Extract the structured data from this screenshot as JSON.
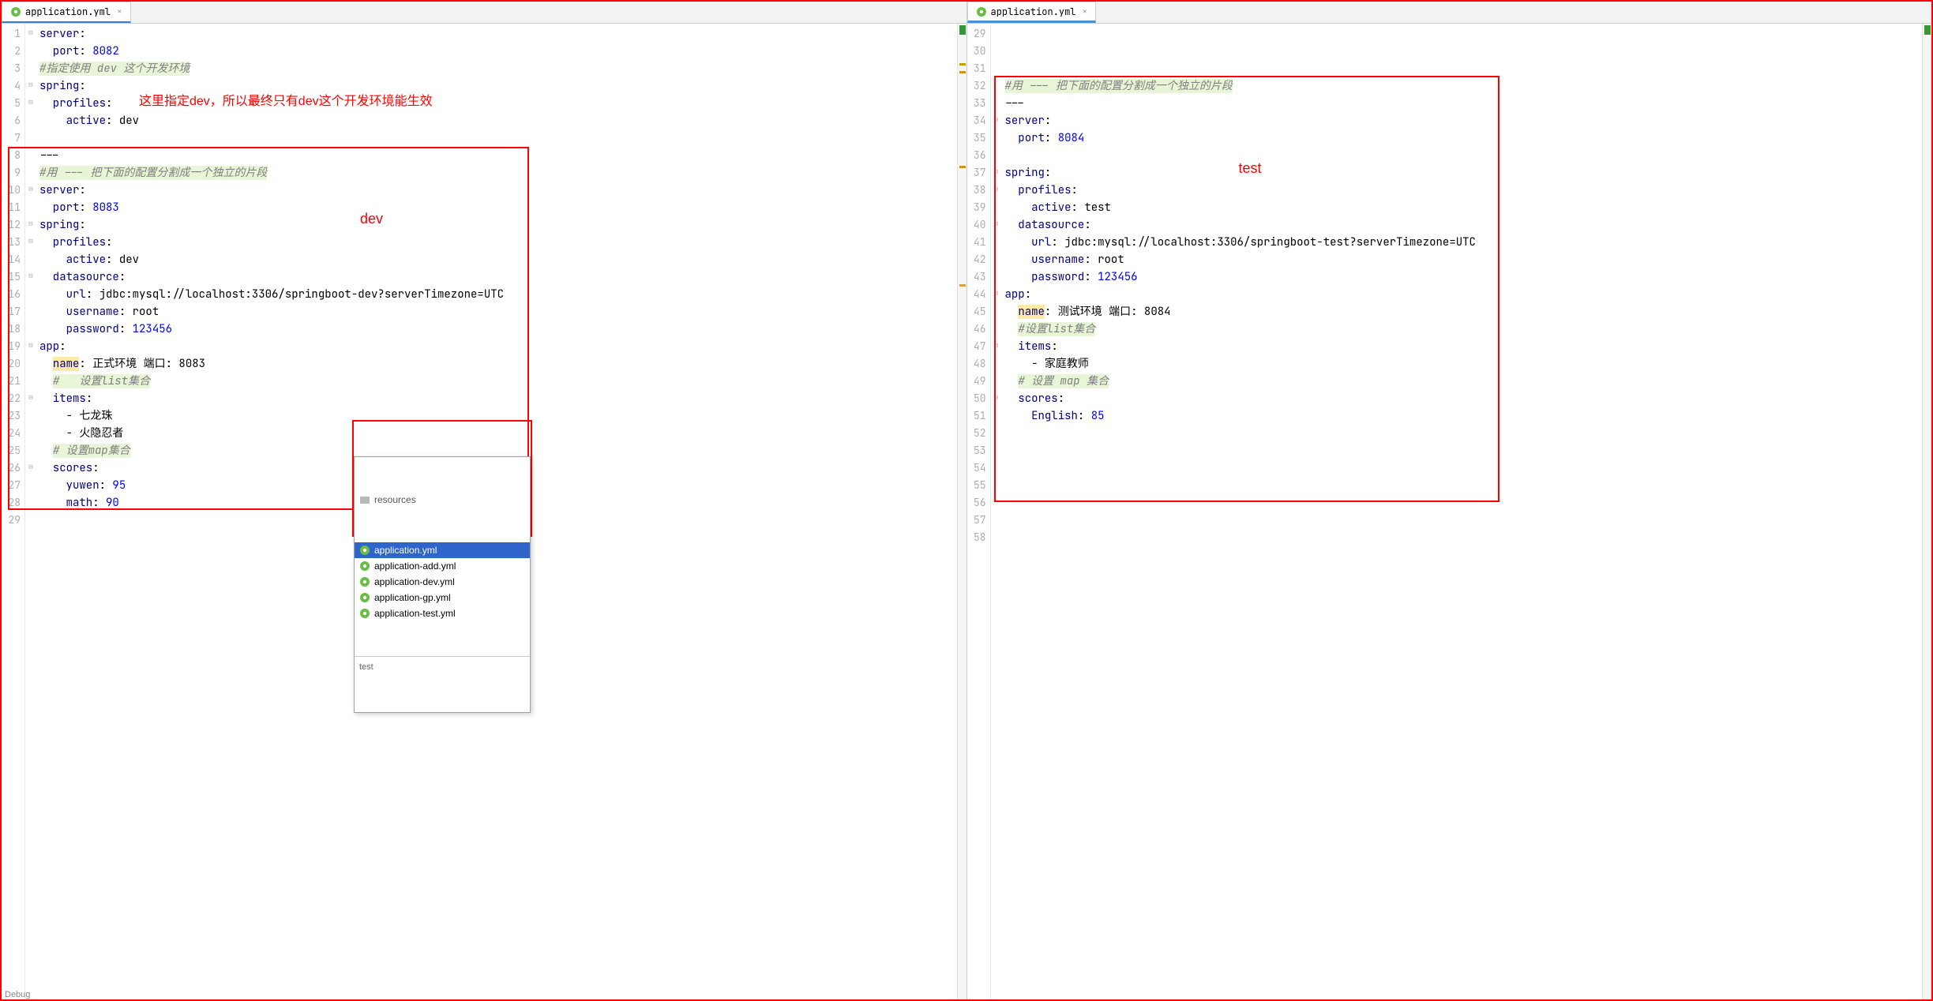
{
  "tab_left": {
    "filename": "application.yml"
  },
  "tab_right": {
    "filename": "application.yml"
  },
  "annotations": {
    "top_red": "这里指定dev，所以最终只有dev这个开发环境能生效",
    "dev_label": "dev",
    "test_label": "test"
  },
  "popup": {
    "folder": "resources",
    "items": [
      "application.yml",
      "application-add.yml",
      "application-dev.yml",
      "application-gp.yml",
      "application-test.yml"
    ],
    "footer": "test"
  },
  "left_code": {
    "start": 1,
    "lines": [
      {
        "t": "key",
        "k": "server",
        "v": "",
        "c": ":"
      },
      {
        "t": "kv",
        "k": "  port",
        "v": "8082",
        "vt": "num"
      },
      {
        "t": "com",
        "txt": "#指定使用 dev 这个开发环境"
      },
      {
        "t": "key",
        "k": "spring",
        "v": "",
        "c": ":"
      },
      {
        "t": "key",
        "k": "  profiles",
        "v": "",
        "c": ":"
      },
      {
        "t": "kv",
        "k": "    active",
        "v": "dev",
        "vt": "str"
      },
      {
        "t": "blank"
      },
      {
        "t": "raw",
        "txt": "---"
      },
      {
        "t": "com",
        "txt": "#用 --- 把下面的配置分割成一个独立的片段"
      },
      {
        "t": "key",
        "k": "server",
        "v": "",
        "c": ":"
      },
      {
        "t": "kv",
        "k": "  port",
        "v": "8083",
        "vt": "num"
      },
      {
        "t": "key",
        "k": "spring",
        "v": "",
        "c": ":"
      },
      {
        "t": "key",
        "k": "  profiles",
        "v": "",
        "c": ":"
      },
      {
        "t": "kv",
        "k": "    active",
        "v": "dev",
        "vt": "str"
      },
      {
        "t": "key",
        "k": "  datasource",
        "v": "",
        "c": ":"
      },
      {
        "t": "kv",
        "k": "    url",
        "v": "jdbc:mysql://localhost:3306/springboot-dev?serverTimezone=UTC",
        "vt": "str"
      },
      {
        "t": "kv",
        "k": "    username",
        "v": "root",
        "vt": "str"
      },
      {
        "t": "kv",
        "k": "    password",
        "v": "123456",
        "vt": "num"
      },
      {
        "t": "key",
        "k": "app",
        "v": "",
        "c": ":"
      },
      {
        "t": "kvh",
        "k": "  name",
        "v": "正式环境 端口: 8083",
        "vt": "str"
      },
      {
        "t": "com",
        "txt": "#   设置list集合",
        "pad": "  "
      },
      {
        "t": "key",
        "k": "  items",
        "v": "",
        "c": ":"
      },
      {
        "t": "raw",
        "txt": "    - 七龙珠"
      },
      {
        "t": "raw",
        "txt": "    - 火隐忍者"
      },
      {
        "t": "com",
        "txt": "# 设置map集合",
        "pad": "  "
      },
      {
        "t": "key",
        "k": "  scores",
        "v": "",
        "c": ":"
      },
      {
        "t": "kv",
        "k": "    yuwen",
        "v": "95",
        "vt": "num"
      },
      {
        "t": "kv",
        "k": "    math",
        "v": "90",
        "vt": "num"
      },
      {
        "t": "blank"
      }
    ]
  },
  "right_code": {
    "start": 29,
    "lines": [
      {
        "t": "blank"
      },
      {
        "t": "blank"
      },
      {
        "t": "blank"
      },
      {
        "t": "com",
        "txt": "#用 --- 把下面的配置分割成一个独立的片段"
      },
      {
        "t": "raw",
        "txt": "---"
      },
      {
        "t": "key",
        "k": "server",
        "v": "",
        "c": ":"
      },
      {
        "t": "kv",
        "k": "  port",
        "v": "8084",
        "vt": "num"
      },
      {
        "t": "blank"
      },
      {
        "t": "key",
        "k": "spring",
        "v": "",
        "c": ":"
      },
      {
        "t": "key",
        "k": "  profiles",
        "v": "",
        "c": ":"
      },
      {
        "t": "kv",
        "k": "    active",
        "v": "test",
        "vt": "str"
      },
      {
        "t": "key",
        "k": "  datasource",
        "v": "",
        "c": ":"
      },
      {
        "t": "kv",
        "k": "    url",
        "v": "jdbc:mysql://localhost:3306/springboot-test?serverTimezone=UTC",
        "vt": "str"
      },
      {
        "t": "kv",
        "k": "    username",
        "v": "root",
        "vt": "str"
      },
      {
        "t": "kv",
        "k": "    password",
        "v": "123456",
        "vt": "num"
      },
      {
        "t": "key",
        "k": "app",
        "v": "",
        "c": ":"
      },
      {
        "t": "kvh",
        "k": "  name",
        "v": "测试环境 端口: 8084",
        "vt": "str"
      },
      {
        "t": "com",
        "txt": "#设置list集合",
        "pad": "  "
      },
      {
        "t": "key",
        "k": "  items",
        "v": "",
        "c": ":"
      },
      {
        "t": "raw",
        "txt": "    - 家庭教师"
      },
      {
        "t": "com",
        "txt": "# 设置 map 集合",
        "pad": "  "
      },
      {
        "t": "key",
        "k": "  scores",
        "v": "",
        "c": ":"
      },
      {
        "t": "kv",
        "k": "    English",
        "v": "85",
        "vt": "num"
      },
      {
        "t": "blank"
      },
      {
        "t": "blank"
      },
      {
        "t": "blank"
      },
      {
        "t": "blank"
      },
      {
        "t": "blank"
      },
      {
        "t": "blank"
      },
      {
        "t": "blank"
      }
    ]
  }
}
